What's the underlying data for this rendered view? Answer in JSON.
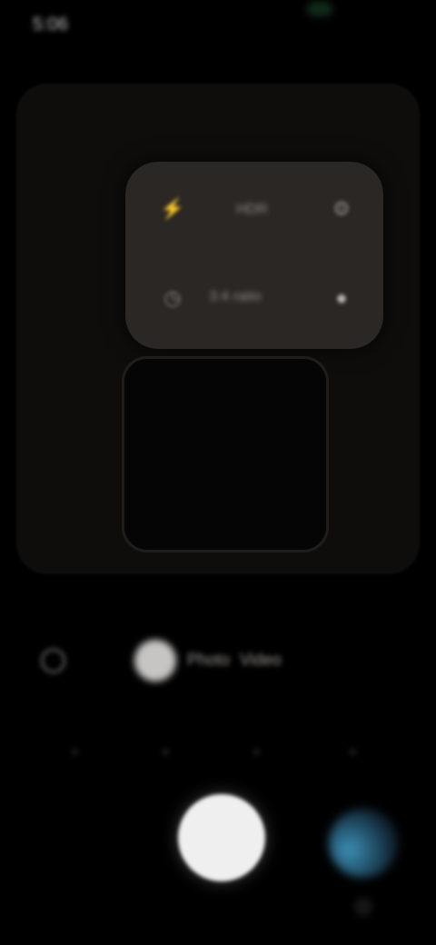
{
  "status_bar": {
    "time": "5:06"
  },
  "control_panel": {
    "top_row": [
      {
        "icon": "flash-icon",
        "glyph": "⚡"
      },
      {
        "label": "HDR"
      },
      {
        "icon": "settings-icon",
        "glyph": "⚙"
      }
    ],
    "bottom_row": [
      {
        "icon": "timer-icon",
        "glyph": "◷"
      },
      {
        "label": "3:4 ratio"
      },
      {
        "icon": "dot-icon",
        "glyph": "●"
      }
    ]
  },
  "modes": {
    "left_icon": "◯",
    "selected_label": "",
    "labels": [
      "Photo",
      "Video"
    ]
  },
  "options": [
    {
      "glyph": "◦"
    },
    {
      "glyph": "◦"
    },
    {
      "glyph": "◦"
    },
    {
      "glyph": "◦"
    }
  ],
  "colors": {
    "background": "#000000",
    "panel": "#2a2725",
    "shutter": "#efefef",
    "accent": "#3b8fb5"
  }
}
